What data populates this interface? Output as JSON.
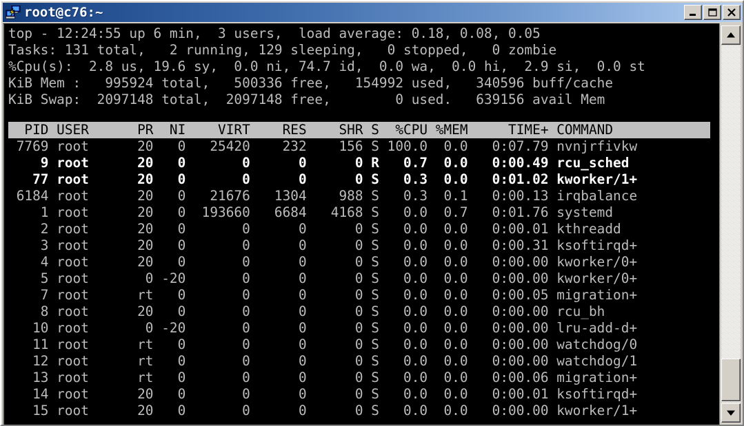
{
  "window": {
    "title": "root@c76:~",
    "icon": "putty-computers-icon",
    "colors": {
      "titlebar_dark": "#123a78",
      "titlebar_light": "#b6d0f0",
      "terminal_bg": "#000000",
      "terminal_fg": "#b8b8b8",
      "terminal_bright_fg": "#ffffff",
      "header_band_bg": "#c0c0c0",
      "chrome_face": "#d4d0c8"
    },
    "buttons": [
      {
        "name": "minimize-button",
        "glyph": "_"
      },
      {
        "name": "maximize-button",
        "glyph": "□"
      },
      {
        "name": "close-button",
        "glyph": "✕"
      }
    ]
  },
  "summary": {
    "line1": "top - 12:24:55 up 6 min,  3 users,  load average: 0.18, 0.08, 0.05",
    "line2": "Tasks: 131 total,   2 running, 129 sleeping,   0 stopped,   0 zombie",
    "line3": "%Cpu(s):  2.8 us, 19.6 sy,  0.0 ni, 74.7 id,  0.0 wa,  0.0 hi,  2.9 si,  0.0 st",
    "line4": "KiB Mem :   995924 total,   500336 free,   154992 used,   340596 buff/cache",
    "line5": "KiB Swap:  2097148 total,  2097148 free,        0 used.   639156 avail Mem",
    "fields": {
      "time": "12:24:55",
      "uptime": "6 min",
      "users": "3",
      "load_avg_1": "0.18",
      "load_avg_5": "0.08",
      "load_avg_15": "0.05",
      "tasks_total": "131",
      "tasks_running": "2",
      "tasks_sleeping": "129",
      "tasks_stopped": "0",
      "tasks_zombie": "0",
      "cpu_us": "2.8",
      "cpu_sy": "19.6",
      "cpu_ni": "0.0",
      "cpu_id": "74.7",
      "cpu_wa": "0.0",
      "cpu_hi": "0.0",
      "cpu_si": "2.9",
      "cpu_st": "0.0",
      "mem_total": "995924",
      "mem_free": "500336",
      "mem_used": "154992",
      "mem_buff_cache": "340596",
      "swap_total": "2097148",
      "swap_free": "2097148",
      "swap_used": "0",
      "swap_avail_mem": "639156"
    }
  },
  "table": {
    "header_line": "  PID USER      PR  NI    VIRT    RES    SHR S  %CPU %MEM     TIME+ COMMAND  ",
    "columns": [
      "PID",
      "USER",
      "PR",
      "NI",
      "VIRT",
      "RES",
      "SHR",
      "S",
      "%CPU",
      "%MEM",
      "TIME+",
      "COMMAND"
    ],
    "rows": [
      {
        "line": " 7769 root      20   0   25420    232    156 S 100.0  0.0   0:07.79 nvnjrfivkw",
        "bright": false,
        "pid": "7769",
        "user": "root",
        "pr": "20",
        "ni": "0",
        "virt": "25420",
        "res": "232",
        "shr": "156",
        "s": "S",
        "cpu": "100.0",
        "mem": "0.0",
        "time": "0:07.79",
        "command": "nvnjrfivkw"
      },
      {
        "line": "    9 root      20   0       0      0      0 R   0.7  0.0   0:00.49 rcu_sched",
        "bright": true,
        "pid": "9",
        "user": "root",
        "pr": "20",
        "ni": "0",
        "virt": "0",
        "res": "0",
        "shr": "0",
        "s": "R",
        "cpu": "0.7",
        "mem": "0.0",
        "time": "0:00.49",
        "command": "rcu_sched"
      },
      {
        "line": "   77 root      20   0       0      0      0 S   0.3  0.0   0:01.02 kworker/1+",
        "bright": true,
        "pid": "77",
        "user": "root",
        "pr": "20",
        "ni": "0",
        "virt": "0",
        "res": "0",
        "shr": "0",
        "s": "S",
        "cpu": "0.3",
        "mem": "0.0",
        "time": "0:01.02",
        "command": "kworker/1+"
      },
      {
        "line": " 6184 root      20   0   21676   1304    988 S   0.3  0.1   0:00.13 irqbalance",
        "bright": false,
        "pid": "6184",
        "user": "root",
        "pr": "20",
        "ni": "0",
        "virt": "21676",
        "res": "1304",
        "shr": "988",
        "s": "S",
        "cpu": "0.3",
        "mem": "0.1",
        "time": "0:00.13",
        "command": "irqbalance"
      },
      {
        "line": "    1 root      20   0  193660   6684   4168 S   0.0  0.7   0:01.76 systemd",
        "bright": false,
        "pid": "1",
        "user": "root",
        "pr": "20",
        "ni": "0",
        "virt": "193660",
        "res": "6684",
        "shr": "4168",
        "s": "S",
        "cpu": "0.0",
        "mem": "0.7",
        "time": "0:01.76",
        "command": "systemd"
      },
      {
        "line": "    2 root      20   0       0      0      0 S   0.0  0.0   0:00.01 kthreadd",
        "bright": false,
        "pid": "2",
        "user": "root",
        "pr": "20",
        "ni": "0",
        "virt": "0",
        "res": "0",
        "shr": "0",
        "s": "S",
        "cpu": "0.0",
        "mem": "0.0",
        "time": "0:00.01",
        "command": "kthreadd"
      },
      {
        "line": "    3 root      20   0       0      0      0 S   0.0  0.0   0:00.31 ksoftirqd+",
        "bright": false,
        "pid": "3",
        "user": "root",
        "pr": "20",
        "ni": "0",
        "virt": "0",
        "res": "0",
        "shr": "0",
        "s": "S",
        "cpu": "0.0",
        "mem": "0.0",
        "time": "0:00.31",
        "command": "ksoftirqd+"
      },
      {
        "line": "    4 root      20   0       0      0      0 S   0.0  0.0   0:00.00 kworker/0+",
        "bright": false,
        "pid": "4",
        "user": "root",
        "pr": "20",
        "ni": "0",
        "virt": "0",
        "res": "0",
        "shr": "0",
        "s": "S",
        "cpu": "0.0",
        "mem": "0.0",
        "time": "0:00.00",
        "command": "kworker/0+"
      },
      {
        "line": "    5 root       0 -20       0      0      0 S   0.0  0.0   0:00.00 kworker/0+",
        "bright": false,
        "pid": "5",
        "user": "root",
        "pr": "0",
        "ni": "-20",
        "virt": "0",
        "res": "0",
        "shr": "0",
        "s": "S",
        "cpu": "0.0",
        "mem": "0.0",
        "time": "0:00.00",
        "command": "kworker/0+"
      },
      {
        "line": "    7 root      rt   0       0      0      0 S   0.0  0.0   0:00.05 migration+",
        "bright": false,
        "pid": "7",
        "user": "root",
        "pr": "rt",
        "ni": "0",
        "virt": "0",
        "res": "0",
        "shr": "0",
        "s": "S",
        "cpu": "0.0",
        "mem": "0.0",
        "time": "0:00.05",
        "command": "migration+"
      },
      {
        "line": "    8 root      20   0       0      0      0 S   0.0  0.0   0:00.00 rcu_bh",
        "bright": false,
        "pid": "8",
        "user": "root",
        "pr": "20",
        "ni": "0",
        "virt": "0",
        "res": "0",
        "shr": "0",
        "s": "S",
        "cpu": "0.0",
        "mem": "0.0",
        "time": "0:00.00",
        "command": "rcu_bh"
      },
      {
        "line": "   10 root       0 -20       0      0      0 S   0.0  0.0   0:00.00 lru-add-d+",
        "bright": false,
        "pid": "10",
        "user": "root",
        "pr": "0",
        "ni": "-20",
        "virt": "0",
        "res": "0",
        "shr": "0",
        "s": "S",
        "cpu": "0.0",
        "mem": "0.0",
        "time": "0:00.00",
        "command": "lru-add-d+"
      },
      {
        "line": "   11 root      rt   0       0      0      0 S   0.0  0.0   0:00.00 watchdog/0",
        "bright": false,
        "pid": "11",
        "user": "root",
        "pr": "rt",
        "ni": "0",
        "virt": "0",
        "res": "0",
        "shr": "0",
        "s": "S",
        "cpu": "0.0",
        "mem": "0.0",
        "time": "0:00.00",
        "command": "watchdog/0"
      },
      {
        "line": "   12 root      rt   0       0      0      0 S   0.0  0.0   0:00.00 watchdog/1",
        "bright": false,
        "pid": "12",
        "user": "root",
        "pr": "rt",
        "ni": "0",
        "virt": "0",
        "res": "0",
        "shr": "0",
        "s": "S",
        "cpu": "0.0",
        "mem": "0.0",
        "time": "0:00.00",
        "command": "watchdog/1"
      },
      {
        "line": "   13 root      rt   0       0      0      0 S   0.0  0.0   0:00.06 migration+",
        "bright": false,
        "pid": "13",
        "user": "root",
        "pr": "rt",
        "ni": "0",
        "virt": "0",
        "res": "0",
        "shr": "0",
        "s": "S",
        "cpu": "0.0",
        "mem": "0.0",
        "time": "0:00.06",
        "command": "migration+"
      },
      {
        "line": "   14 root      20   0       0      0      0 S   0.0  0.0   0:00.01 ksoftirqd+",
        "bright": false,
        "pid": "14",
        "user": "root",
        "pr": "20",
        "ni": "0",
        "virt": "0",
        "res": "0",
        "shr": "0",
        "s": "S",
        "cpu": "0.0",
        "mem": "0.0",
        "time": "0:00.01",
        "command": "ksoftirqd+"
      },
      {
        "line": "   15 root      20   0       0      0      0 S   0.0  0.0   0:00.00 kworker/1+",
        "bright": false,
        "pid": "15",
        "user": "root",
        "pr": "20",
        "ni": "0",
        "virt": "0",
        "res": "0",
        "shr": "0",
        "s": "S",
        "cpu": "0.0",
        "mem": "0.0",
        "time": "0:00.00",
        "command": "kworker/1+"
      }
    ]
  },
  "scrollbar": {
    "up_arrow": "scroll-up-arrow",
    "down_arrow": "scroll-down-arrow"
  }
}
